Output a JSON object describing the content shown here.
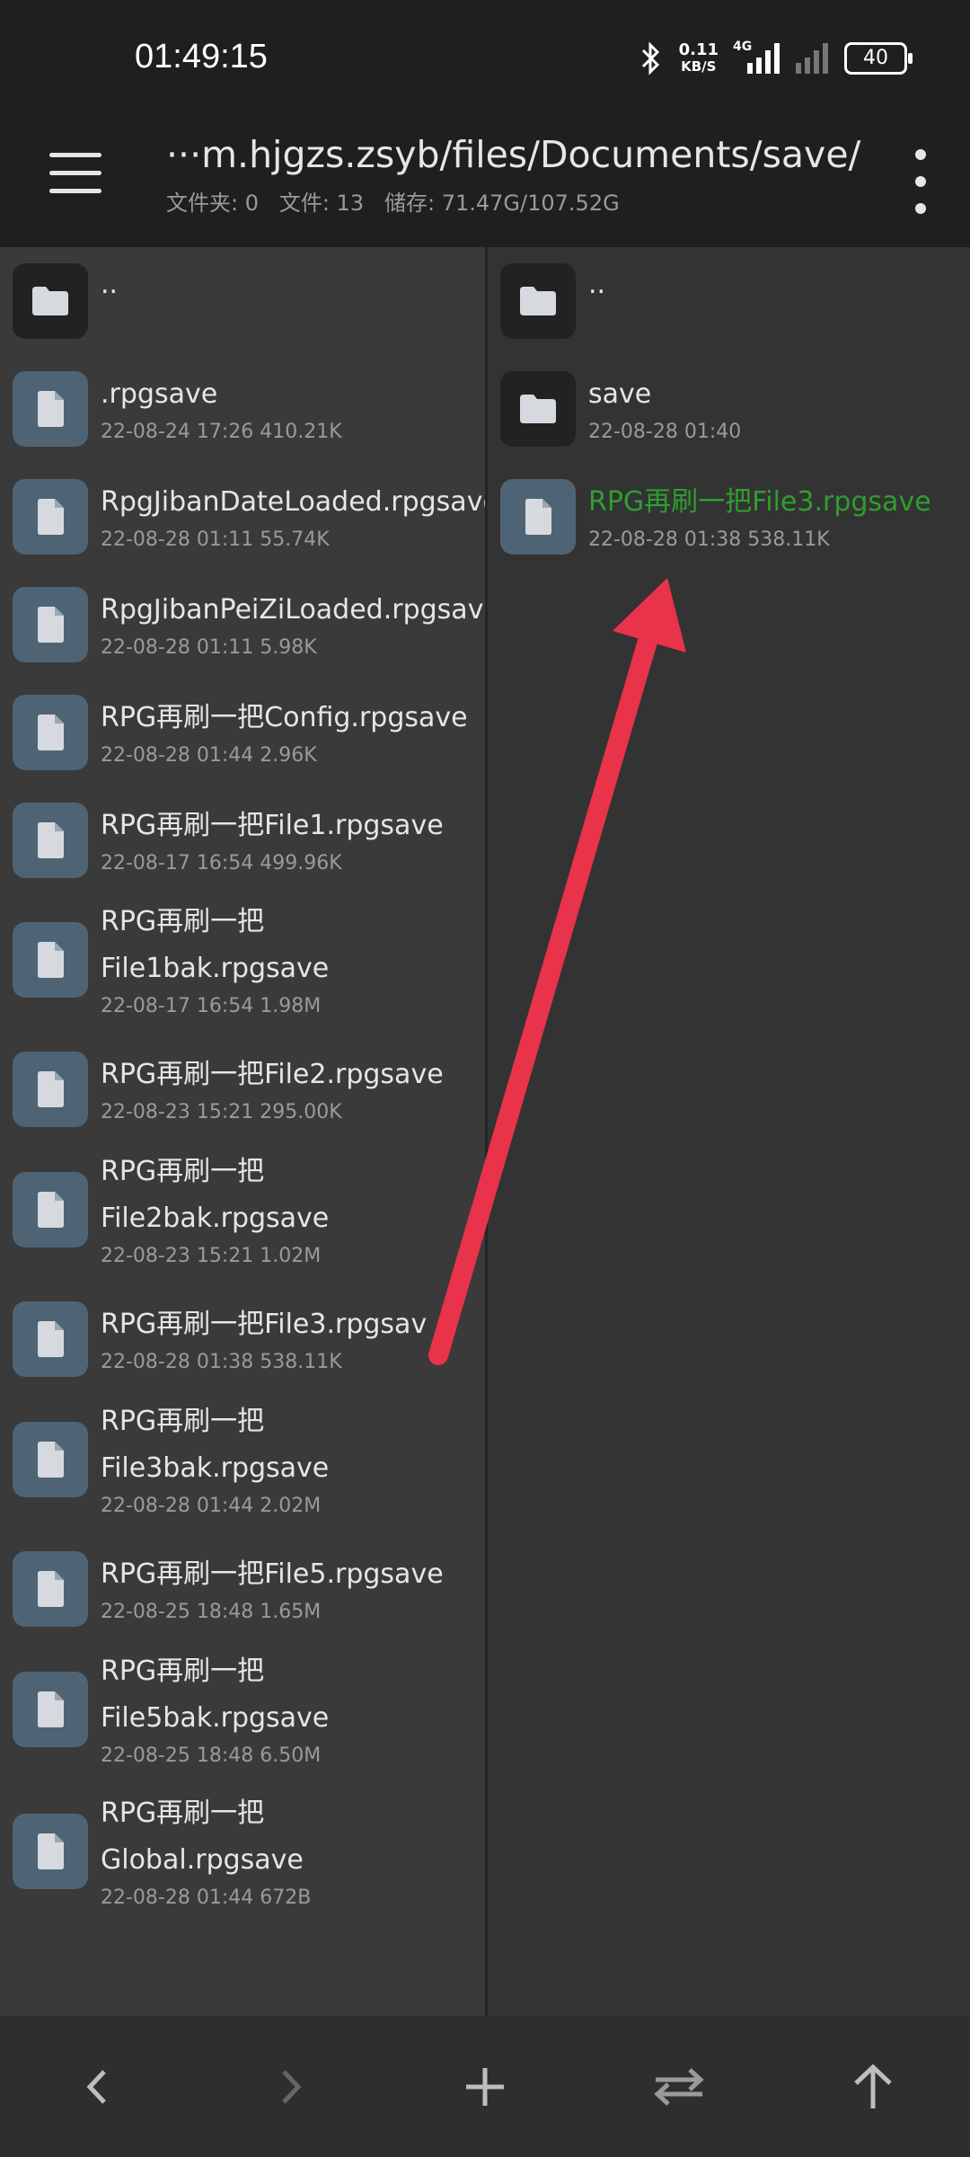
{
  "status": {
    "time": "01:49:15",
    "net_speed_value": "0.11",
    "net_speed_unit": "KB/S",
    "network": "4G",
    "battery": "40"
  },
  "appbar": {
    "path": "···m.hjgzs.zsyb/files/Documents/save/",
    "info": "文件夹: 0   文件: 13   储存: 71.47G/107.52G"
  },
  "left_pane": {
    "items": [
      {
        "name": "..",
        "type": "folder"
      },
      {
        "name": ".rpgsave",
        "meta": "22-08-24 17:26 410.21K"
      },
      {
        "name": "RpgJibanDateLoaded.rpgsave",
        "meta": "22-08-28 01:11 55.74K"
      },
      {
        "name": "RpgJibanPeiZiLoaded.rpgsave",
        "meta": "22-08-28 01:11 5.98K"
      },
      {
        "name": "RPG再刷一把Config.rpgsave",
        "meta": "22-08-28 01:44 2.96K"
      },
      {
        "name": "RPG再刷一把File1.rpgsave",
        "meta": "22-08-17 16:54 499.96K"
      },
      {
        "name1": "RPG再刷一把",
        "name2": "File1bak.rpgsave",
        "meta": "22-08-17 16:54 1.98M"
      },
      {
        "name": "RPG再刷一把File2.rpgsave",
        "meta": "22-08-23 15:21 295.00K"
      },
      {
        "name1": "RPG再刷一把",
        "name2": "File2bak.rpgsave",
        "meta": "22-08-23 15:21 1.02M"
      },
      {
        "name": "RPG再刷一把File3.rpgsav",
        "meta": "22-08-28 01:38 538.11K"
      },
      {
        "name1": "RPG再刷一把",
        "name2": "File3bak.rpgsave",
        "meta": "22-08-28 01:44 2.02M"
      },
      {
        "name": "RPG再刷一把File5.rpgsave",
        "meta": "22-08-25 18:48 1.65M"
      },
      {
        "name1": "RPG再刷一把",
        "name2": "File5bak.rpgsave",
        "meta": "22-08-25 18:48 6.50M"
      },
      {
        "name1": "RPG再刷一把",
        "name2": "Global.rpgsave",
        "meta": "22-08-28 01:44 672B"
      }
    ]
  },
  "right_pane": {
    "items": [
      {
        "name": "..",
        "type": "folder"
      },
      {
        "name": "save",
        "meta": "22-08-28 01:40",
        "type": "folder"
      },
      {
        "name": "RPG再刷一把File3.rpgsave",
        "meta": "22-08-28 01:38 538.11K",
        "highlight_color": "#2e9e2e"
      }
    ]
  },
  "colors": {
    "annotation_arrow": "#e8334a",
    "file_icon_bg": "#4e6475",
    "folder_icon_bg": "#222222"
  }
}
